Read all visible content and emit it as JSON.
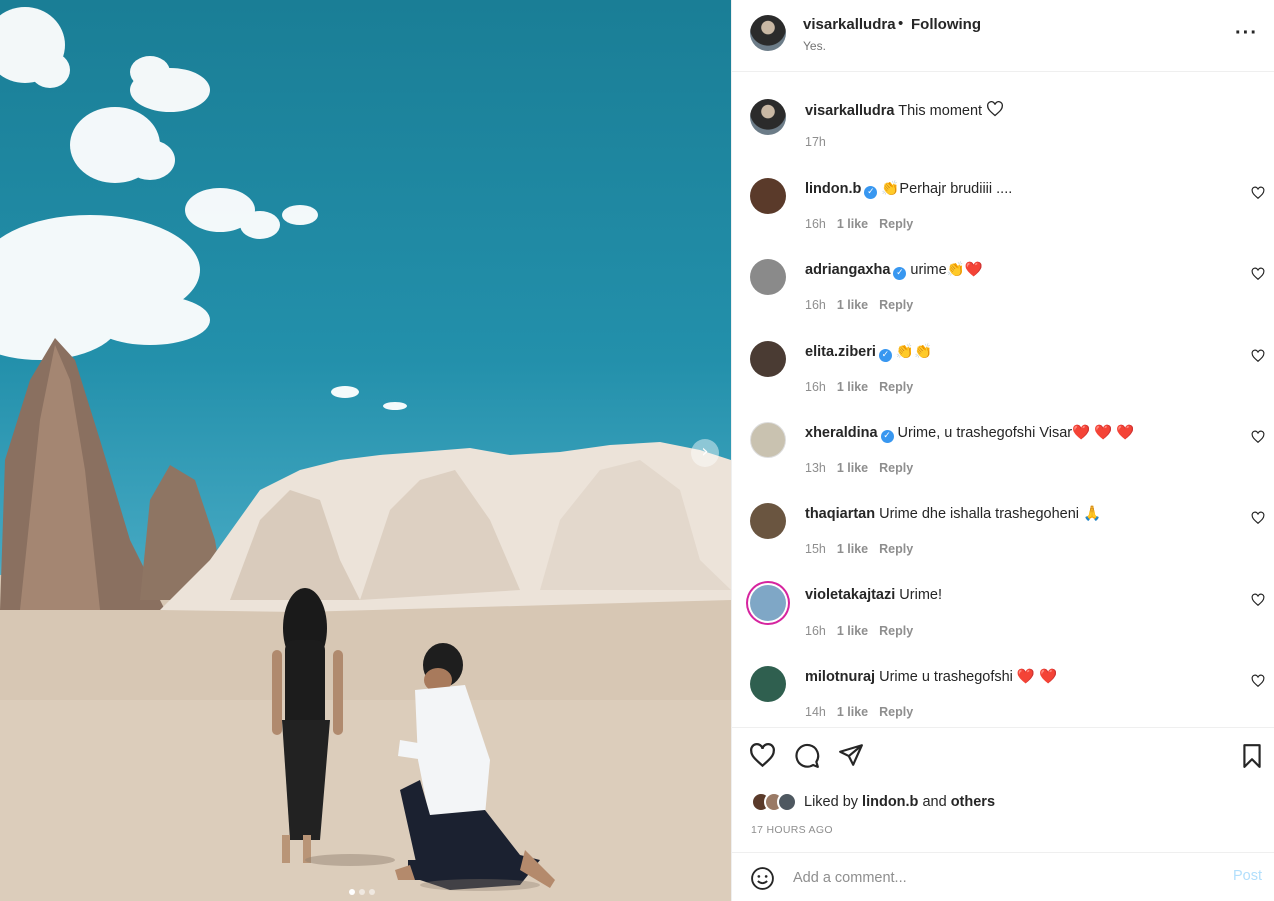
{
  "post": {
    "author": "visarkalludra",
    "follow_state": "Following",
    "separator": "•",
    "subtitle": "Yes.",
    "caption": {
      "user": "visarkalludra",
      "text": "This moment ",
      "time": "17h"
    }
  },
  "comments": [
    {
      "user": "lindon.b",
      "verified": true,
      "text": "👏Perhajr brudiiii ....",
      "time": "16h",
      "likes": "1 like",
      "reply": "Reply",
      "avatar_color": "#5a3a2a"
    },
    {
      "user": "adriangaxha",
      "verified": true,
      "text": "urime👏❤️",
      "time": "16h",
      "likes": "1 like",
      "reply": "Reply",
      "avatar_color": "#8a8a8a"
    },
    {
      "user": "elita.ziberi",
      "verified": true,
      "text": "👏👏",
      "time": "16h",
      "likes": "1 like",
      "reply": "Reply",
      "avatar_color": "#4a3b33"
    },
    {
      "user": "xheraldina",
      "verified": true,
      "text": "Urime, u trashegofshi Visar❤️ ❤️ ❤️",
      "time": "13h",
      "likes": "1 like",
      "reply": "Reply",
      "avatar_color": "#c9c2b0"
    },
    {
      "user": "thaqiartan",
      "verified": false,
      "text": "Urime dhe ishalla trashegoheni 🙏",
      "time": "15h",
      "likes": "1 like",
      "reply": "Reply",
      "avatar_color": "#6a5540"
    },
    {
      "user": "violetakajtazi",
      "verified": false,
      "text": "Urime!",
      "time": "16h",
      "likes": "1 like",
      "reply": "Reply",
      "avatar_color": "#7fa7c6"
    },
    {
      "user": "milotnuraj",
      "verified": false,
      "text": "Urime u trashegofshi ❤️ ❤️",
      "time": "14h",
      "likes": "1 like",
      "reply": "Reply",
      "avatar_color": "#2f5f4f"
    }
  ],
  "likes": {
    "prefix": "Liked by",
    "user": "lindon.b",
    "and": "and",
    "others": "others"
  },
  "timestamp": "17 HOURS AGO",
  "add_comment": {
    "placeholder": "Add a comment...",
    "post_label": "Post"
  },
  "icons": {
    "like": "heart-icon",
    "comment": "comment-bubble-icon",
    "share": "paper-plane-icon",
    "save": "bookmark-icon",
    "emoji": "smiley-icon",
    "more": "more-options-icon",
    "next": "chevron-right-icon"
  },
  "carousel": {
    "slides": 3,
    "active": 1
  },
  "colors": {
    "accent_blue": "#3897f0",
    "post_disabled": "#b2dffc",
    "heart_red": "#ed4956",
    "story_ring": "#d6249f"
  }
}
